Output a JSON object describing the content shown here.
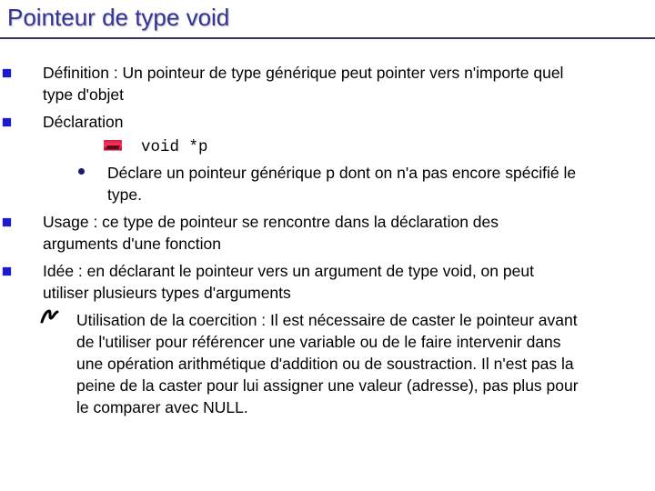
{
  "slide": {
    "title": "Pointeur de type void",
    "colors": {
      "title": "#333399",
      "rule": "#333366",
      "bullet_square": "#1a1ad0",
      "bullet_dot": "#1a1a6a"
    },
    "items": [
      {
        "bullet_icon": "square-bullet-icon",
        "lines": [
          "Définition :  Un pointeur de type générique peut pointer vers n'importe quel",
          "type d'objet"
        ]
      },
      {
        "bullet_icon": "square-bullet-icon",
        "lines": [
          "Déclaration"
        ],
        "code": {
          "icon": "picture-bullet-icon",
          "text": "void *p"
        },
        "sub": {
          "bullet_icon": "dot-bullet-icon",
          "lines": [
            "Déclare un pointeur générique p dont on n'a pas encore spécifié le",
            "type."
          ]
        }
      },
      {
        "bullet_icon": "square-bullet-icon",
        "lines": [
          "Usage : ce type de pointeur se rencontre dans la déclaration des",
          "arguments d'une fonction"
        ]
      },
      {
        "bullet_icon": "square-bullet-icon",
        "lines": [
          "Idée : en déclarant le pointeur vers un argument de type void, on peut",
          "utiliser plusieurs types d'arguments"
        ],
        "sub": {
          "bullet_icon": "swirl-bullet-icon",
          "lines": [
            "Utilisation de la coercition : Il est nécessaire de caster le pointeur avant",
            "de l'utiliser pour référencer une variable ou de le faire intervenir dans",
            "une opération arithmétique d'addition ou de soustraction. Il n'est pas la",
            "peine de la caster pour lui assigner une valeur (adresse), pas plus pour",
            "le comparer avec NULL."
          ]
        }
      }
    ]
  }
}
